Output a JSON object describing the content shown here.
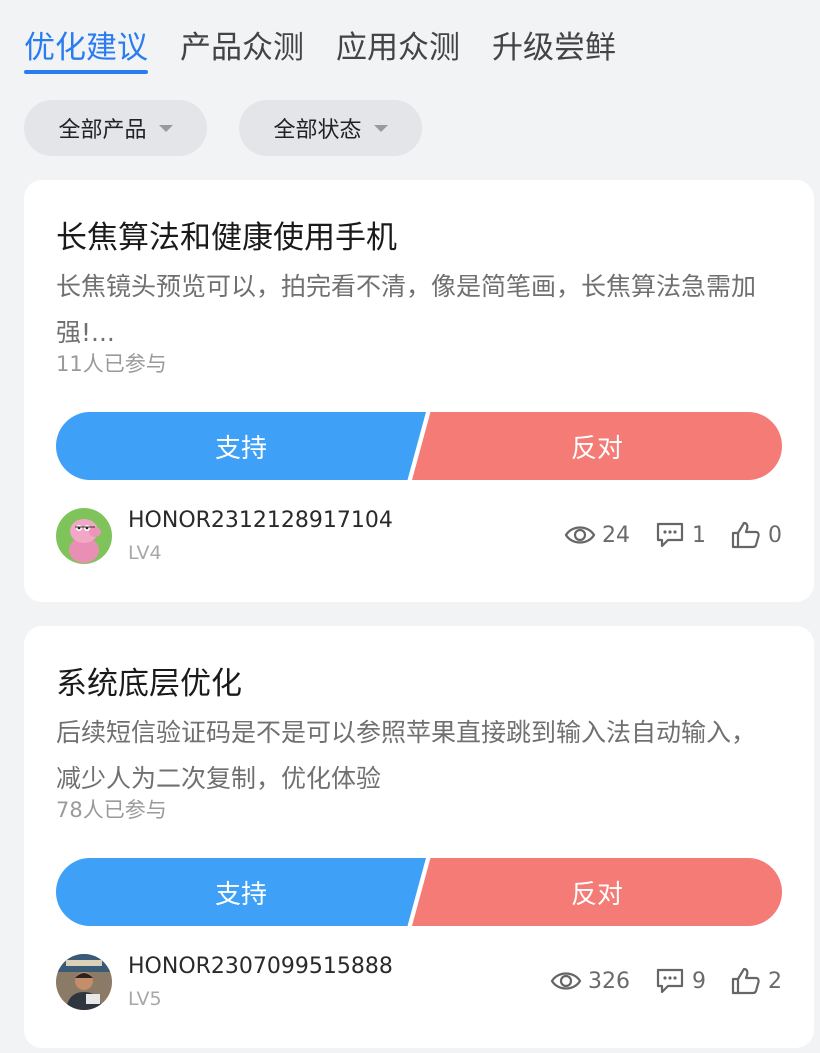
{
  "tabs": [
    {
      "label": "优化建议"
    },
    {
      "label": "产品众测"
    },
    {
      "label": "应用众测"
    },
    {
      "label": "升级尝鲜"
    }
  ],
  "filters": [
    {
      "label": "全部产品"
    },
    {
      "label": "全部状态"
    }
  ],
  "posts": [
    {
      "title": "长焦算法和健康使用手机",
      "description": "长焦镜头预览可以，拍完看不清，像是简笔画，长焦算法急需加强!...",
      "participants": "11人已参与",
      "support_label": "支持",
      "oppose_label": "反对",
      "username": "HONOR2312128917104",
      "level": "LV4",
      "views": "24",
      "comments": "1",
      "likes": "0"
    },
    {
      "title": "系统底层优化",
      "description": "后续短信验证码是不是可以参照苹果直接跳到输入法自动输入，减少人为二次复制，优化体验",
      "participants": "78人已参与",
      "support_label": "支持",
      "oppose_label": "反对",
      "username": "HONOR2307099515888",
      "level": "LV5",
      "views": "326",
      "comments": "9",
      "likes": "2"
    }
  ],
  "colors": {
    "accent": "#2a7cf0",
    "support": "#3ea0f7",
    "oppose": "#f47b76"
  }
}
